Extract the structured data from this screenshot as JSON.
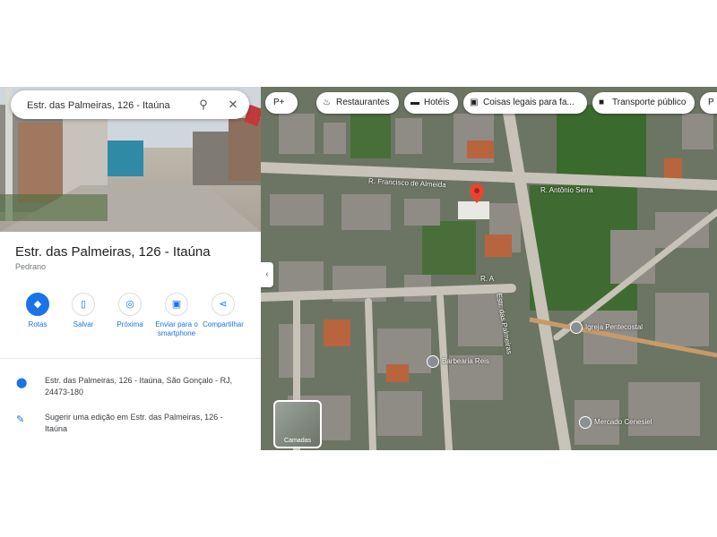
{
  "search": {
    "value": "Estr. das Palmeiras, 126 - Itaúna",
    "search_icon": "search-icon",
    "close_icon": "close-icon"
  },
  "place": {
    "title": "Estr. das Palmeiras, 126 - Itaúna",
    "subtitle": "Pedrano"
  },
  "actions": [
    {
      "label": "Rotas",
      "icon": "directions-icon",
      "glyph": "◆"
    },
    {
      "label": "Salvar",
      "icon": "bookmark-icon",
      "glyph": "▯"
    },
    {
      "label": "Próxima",
      "icon": "nearby-icon",
      "glyph": "◎"
    },
    {
      "label": "Enviar para o smartphone",
      "icon": "send-to-phone-icon",
      "glyph": "▣"
    },
    {
      "label": "Compartilhar",
      "icon": "share-icon",
      "glyph": "⋖"
    }
  ],
  "info": [
    {
      "icon": "location-pin-icon",
      "text": "Estr. das Palmeiras, 126 - Itaúna, São Gonçalo - RJ, 24473-180"
    },
    {
      "icon": "edit-pencil-icon",
      "text": "Sugerir uma edição em Estr. das Palmeiras, 126 - Itaúna"
    }
  ],
  "map": {
    "chips": [
      {
        "label": "Restaurantes",
        "icon": "restaurant-icon"
      },
      {
        "label": "Hotéis",
        "icon": "hotel-icon"
      },
      {
        "label": "Coisas legais para fa...",
        "icon": "camera-icon"
      },
      {
        "label": "Transporte público",
        "icon": "bus-icon"
      },
      {
        "label": "P",
        "icon": "parking-icon"
      }
    ],
    "layer_toggle": "P+",
    "roads": [
      "R. Francisco de Almeida",
      "Estr. das Palmeiras",
      "R. A",
      "R. Antônio Serra"
    ],
    "places": [
      "Barbearia Reis",
      "Igreja Pentecostal",
      "Mercado Cenesiel"
    ],
    "layers_label": "Camadas",
    "accent": "#1a73e8",
    "pin_color": "#ea4335"
  }
}
